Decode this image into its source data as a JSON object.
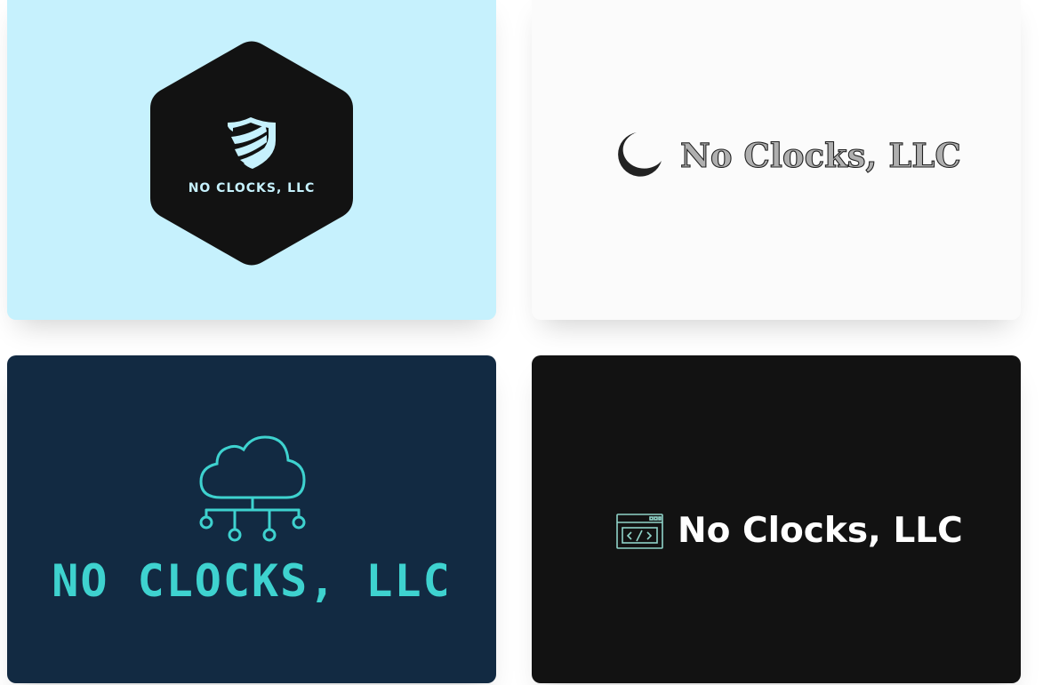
{
  "logos": [
    {
      "name": "NO CLOCKS, LLC",
      "style": "hexagon-shield",
      "background": "#c6f1fd",
      "accent": "#121212",
      "icon": "shield-icon"
    },
    {
      "name": "No Clocks, LLC",
      "style": "serif-crescent",
      "background": "#fbfbfb",
      "accent": "#222222",
      "icon": "crescent-icon"
    },
    {
      "name": "NO CLOCKS, LLC",
      "style": "cloud-network",
      "background": "#122a42",
      "accent": "#3ed2cf",
      "icon": "cloud-network-icon"
    },
    {
      "name": "No Clocks, LLC",
      "style": "code-window",
      "background": "#121212",
      "accent": "#8fd3c8",
      "icon": "code-window-icon"
    }
  ]
}
